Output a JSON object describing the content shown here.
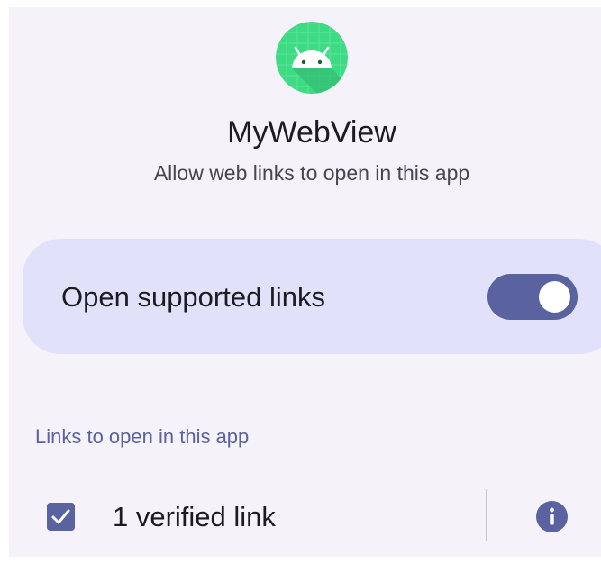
{
  "app": {
    "name": "MyWebView",
    "subtitle": "Allow web links to open in this app",
    "icon": "android-robot-icon"
  },
  "open_supported_links": {
    "label": "Open supported links",
    "toggle_state": "on"
  },
  "links_section": {
    "header": "Links to open in this app",
    "items": [
      {
        "label": "1 verified link",
        "checked": true,
        "info_icon": "info-icon"
      }
    ]
  },
  "colors": {
    "background": "#f5f2f9",
    "card": "#e1e2fa",
    "accent": "#5a62a0",
    "app_icon_green": "#3ddc84"
  }
}
